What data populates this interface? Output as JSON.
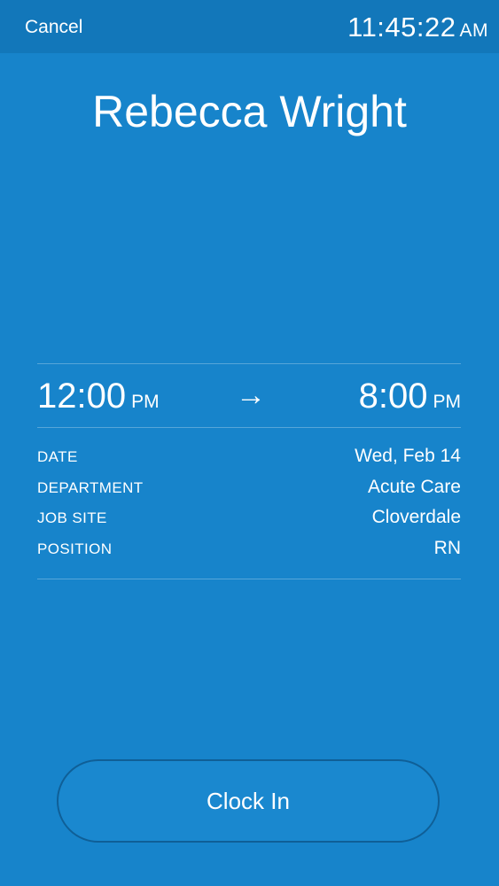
{
  "header": {
    "cancel_label": "Cancel",
    "clock_time": "11:45:22",
    "clock_ampm": "AM"
  },
  "employee": {
    "name": "Rebecca Wright"
  },
  "shift": {
    "start_time": "12:00",
    "start_ampm": "PM",
    "arrow": "→",
    "end_time": "8:00",
    "end_ampm": "PM"
  },
  "details": [
    {
      "label": "DATE",
      "value": "Wed, Feb 14"
    },
    {
      "label": "DEPARTMENT",
      "value": "Acute Care"
    },
    {
      "label": "JOB SITE",
      "value": "Cloverdale"
    },
    {
      "label": "POSITION",
      "value": "RN"
    }
  ],
  "actions": {
    "clock_in_label": "Clock In"
  },
  "colors": {
    "background": "#1784cb",
    "topbar": "#1277ba",
    "button_border": "#0f5f97"
  }
}
